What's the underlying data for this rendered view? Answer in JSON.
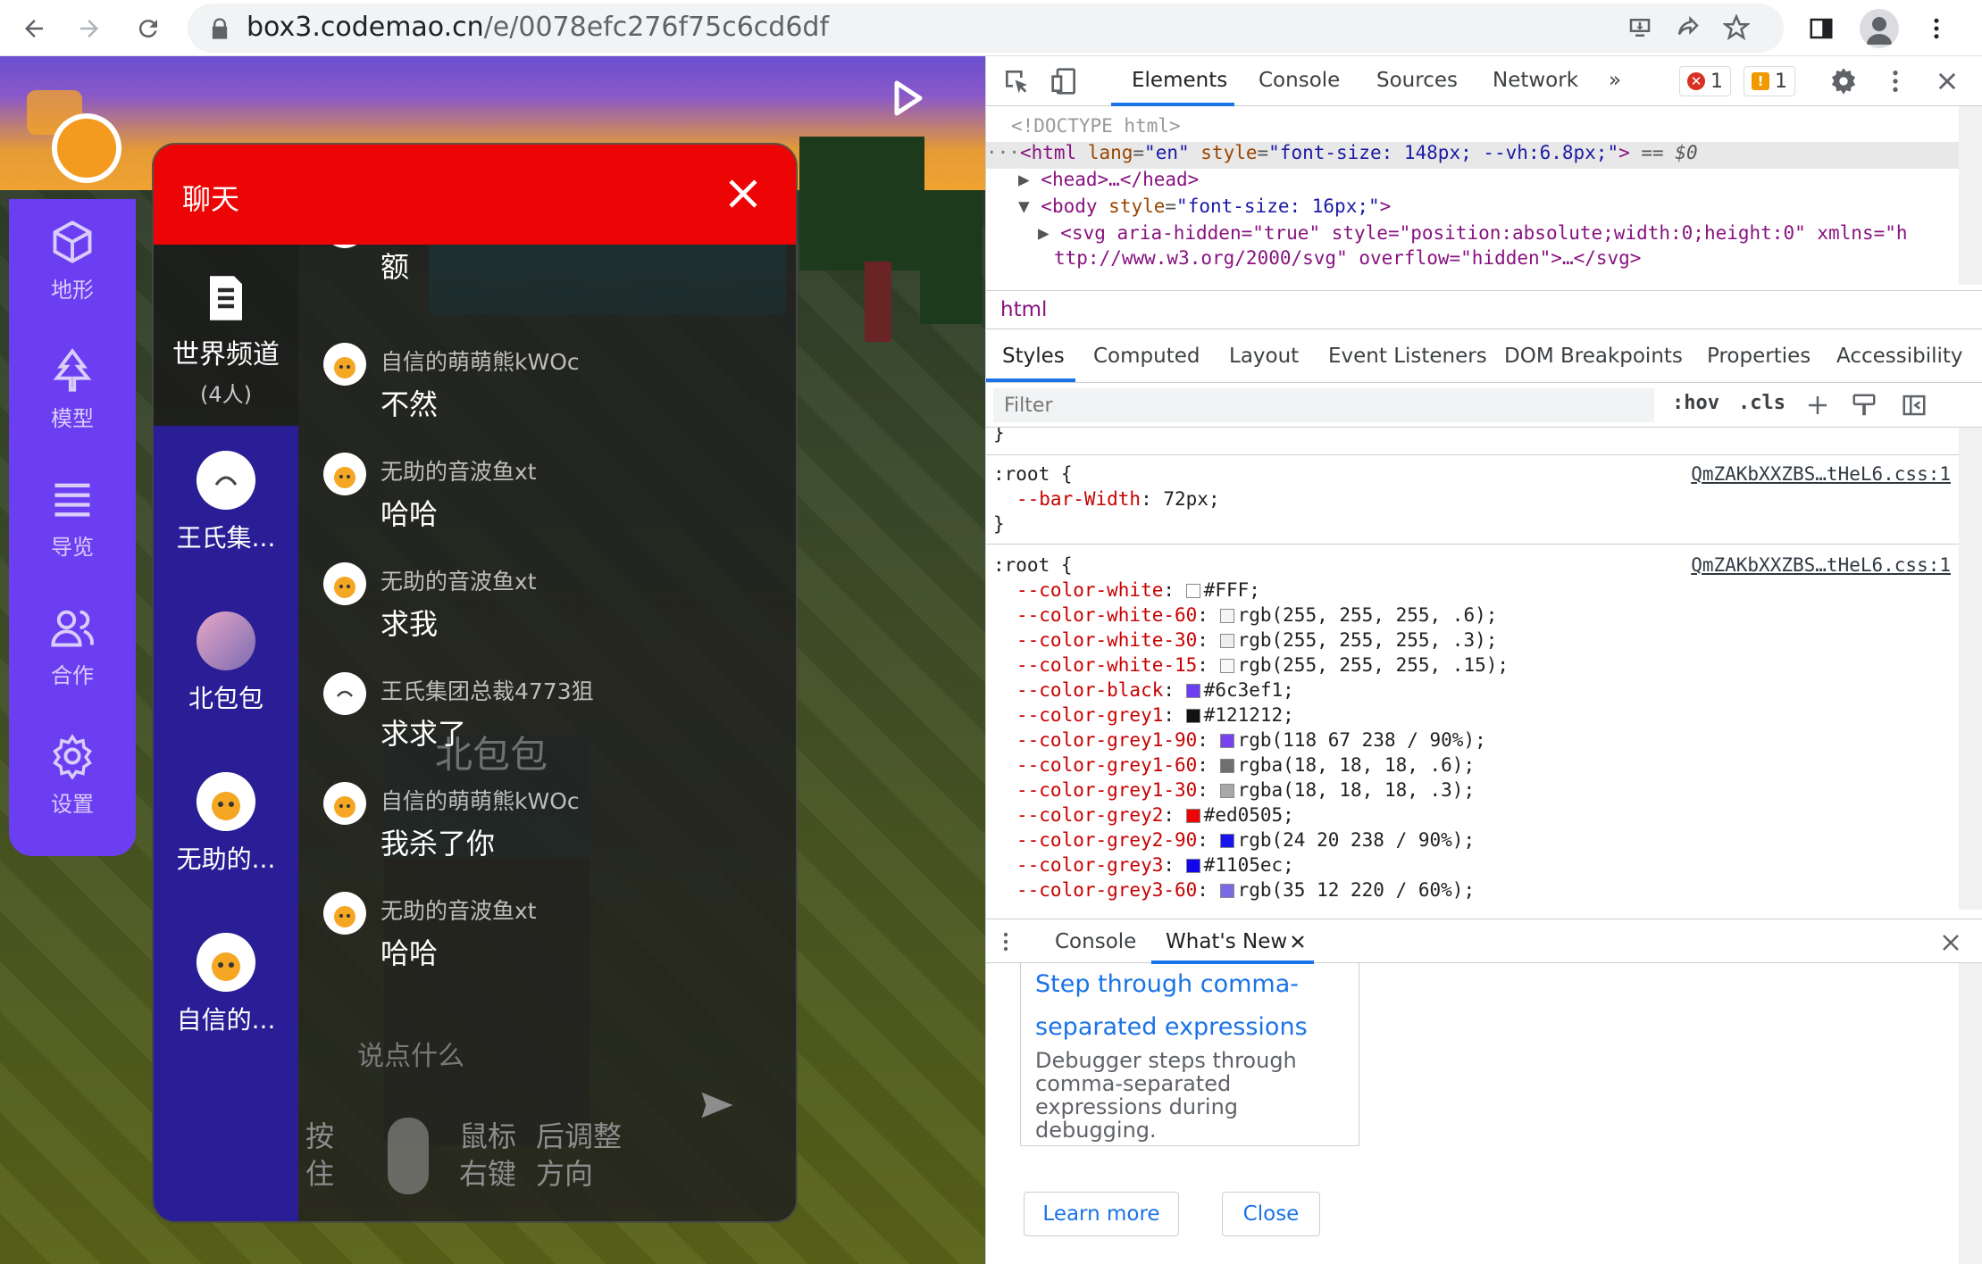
{
  "browser": {
    "url_host": "box3.codemao.cn",
    "url_path": "/e/0078efc276f75c6cd6df"
  },
  "game": {
    "sidebar": [
      {
        "label": "地形",
        "icon": "cube-icon"
      },
      {
        "label": "模型",
        "icon": "tree-icon"
      },
      {
        "label": "导览",
        "icon": "list-icon"
      },
      {
        "label": "合作",
        "icon": "users-icon"
      },
      {
        "label": "设置",
        "icon": "gear-icon"
      }
    ],
    "chat": {
      "title": "聊天",
      "world_channel": {
        "name": "世界频道",
        "count": "(4人)"
      },
      "channels": [
        {
          "name": "王氏集..."
        },
        {
          "name": "北包包"
        },
        {
          "name": "无助的..."
        },
        {
          "name": "自信的..."
        }
      ],
      "messages": [
        {
          "who": "",
          "text": "额"
        },
        {
          "who": "自信的萌萌熊kWOc",
          "text": "不然"
        },
        {
          "who": "无助的音波鱼xt",
          "text": "哈哈"
        },
        {
          "who": "无助的音波鱼xt",
          "text": "求我"
        },
        {
          "who": "王氏集团总裁4773狙",
          "text": "求求了"
        },
        {
          "who": "自信的萌萌熊kWOc",
          "text": "我杀了你"
        },
        {
          "who": "无助的音波鱼xt",
          "text": "哈哈"
        }
      ],
      "ghost_name": "北包包",
      "input_placeholder": "说点什么",
      "hint": {
        "press": "按住",
        "button": "鼠标右键",
        "action": "后调整方向"
      }
    }
  },
  "devtools": {
    "tabs": [
      "Elements",
      "Console",
      "Sources",
      "Network"
    ],
    "more": "»",
    "errors": "1",
    "warnings": "1",
    "dom": {
      "doctype": "<!DOCTYPE html>",
      "html_open": "<html",
      "html_lang_attr": "lang",
      "html_lang_val": "\"en\"",
      "html_style_attr": "style",
      "html_style_val": "\"font-size: 148px; --vh:6.8px;\"",
      "html_eq": "== $0",
      "head": "<head>…</head>",
      "body_open": "<body",
      "body_style_val": "\"font-size: 16px;\"",
      "svg_line1": "<svg aria-hidden=\"true\" style=\"position:absolute;width:0;height:0\" xmlns=\"h",
      "svg_line2": "ttp://www.w3.org/2000/svg\" overflow=\"hidden\">…</svg>"
    },
    "breadcrumb": "html",
    "sub_tabs": [
      "Styles",
      "Computed",
      "Layout",
      "Event Listeners",
      "DOM Breakpoints",
      "Properties",
      "Accessibility"
    ],
    "filter_placeholder": "Filter",
    "hov": ":hov",
    "cls": ".cls",
    "rules": [
      {
        "selector": ":root {",
        "source": "QmZAKbXXZBS…tHeL6.css:1",
        "props": [
          {
            "name": "--bar-Width",
            "value": "72px;",
            "swatch": ""
          }
        ]
      },
      {
        "selector": ":root {",
        "source": "QmZAKbXXZBS…tHeL6.css:1",
        "props": [
          {
            "name": "--color-white",
            "value": "#FFF;",
            "swatch": "#ffffff"
          },
          {
            "name": "--color-white-60",
            "value": "rgb(255, 255, 255, .6);",
            "swatch": "#f4f4f4"
          },
          {
            "name": "--color-white-30",
            "value": "rgb(255, 255, 255, .3);",
            "swatch": "#eeeeee"
          },
          {
            "name": "--color-white-15",
            "value": "rgb(255, 255, 255, .15);",
            "swatch": "#f8f8f8"
          },
          {
            "name": "--color-black",
            "value": "#6c3ef1;",
            "swatch": "#6c3ef1"
          },
          {
            "name": "--color-grey1",
            "value": "#121212;",
            "swatch": "#121212"
          },
          {
            "name": "--color-grey1-90",
            "value": "rgb(118 67 238 / 90%);",
            "swatch": "#7643ee"
          },
          {
            "name": "--color-grey1-60",
            "value": "rgba(18, 18, 18, .6);",
            "swatch": "#6f6f6f"
          },
          {
            "name": "--color-grey1-30",
            "value": "rgba(18, 18, 18, .3);",
            "swatch": "#a8a8a8"
          },
          {
            "name": "--color-grey2",
            "value": "#ed0505;",
            "swatch": "#ed0505"
          },
          {
            "name": "--color-grey2-90",
            "value": "rgb(24 20 238 / 90%);",
            "swatch": "#1814ee"
          },
          {
            "name": "--color-grey3",
            "value": "#1105ec;",
            "swatch": "#1105ec"
          },
          {
            "name": "--color-grey3-60",
            "value": "rgb(35 12 220 / 60%);",
            "swatch": "#7a6ae4"
          }
        ]
      }
    ],
    "drawer_tabs": [
      "Console",
      "What's New"
    ],
    "whats_new": {
      "heading": "Step through comma-separated expressions",
      "desc": "Debugger steps through comma-separated expressions during debugging.",
      "learn_more": "Learn more",
      "close": "Close"
    }
  }
}
